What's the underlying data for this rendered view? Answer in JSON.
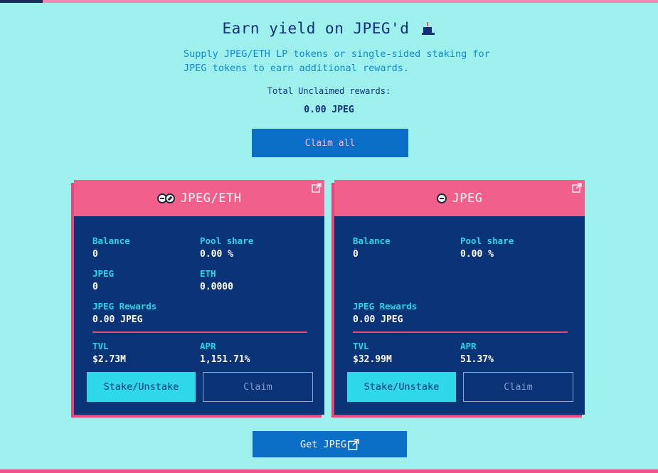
{
  "hero": {
    "title": "Earn yield on JPEG'd",
    "subtitle": "Supply JPEG/ETH LP tokens or single-sided staking for JPEG tokens to earn additional rewards.",
    "total_label": "Total Unclaimed rewards:",
    "total_value": "0.00 JPEG",
    "claim_all_label": "Claim all"
  },
  "pools": [
    {
      "title": "JPEG/ETH",
      "balance_label": "Balance",
      "balance": "0",
      "share_label": "Pool share",
      "share": "0.00 %",
      "jpeg_label": "JPEG",
      "jpeg": "0",
      "eth_label": "ETH",
      "eth": "0.0000",
      "rewards_label": "JPEG Rewards",
      "rewards": "0.00 JPEG",
      "tvl_label": "TVL",
      "tvl": "$2.73M",
      "apr_label": "APR",
      "apr": "1,151.71%",
      "stake_label": "Stake/Unstake",
      "claim_label": "Claim"
    },
    {
      "title": "JPEG",
      "balance_label": "Balance",
      "balance": "0",
      "share_label": "Pool share",
      "share": "0.00 %",
      "rewards_label": "JPEG Rewards",
      "rewards": "0.00 JPEG",
      "tvl_label": "TVL",
      "tvl": "$32.99M",
      "apr_label": "APR",
      "apr": "51.37%",
      "stake_label": "Stake/Unstake",
      "claim_label": "Claim"
    }
  ],
  "footer": {
    "get_jpeg_label": "Get JPEG"
  },
  "colors": {
    "background": "#9ef0ec",
    "card": "#0b3478",
    "card_header": "#f0608a",
    "accent_cyan": "#2ed8e8",
    "button_blue": "#0b6fc7",
    "pink": "#e7457c"
  }
}
